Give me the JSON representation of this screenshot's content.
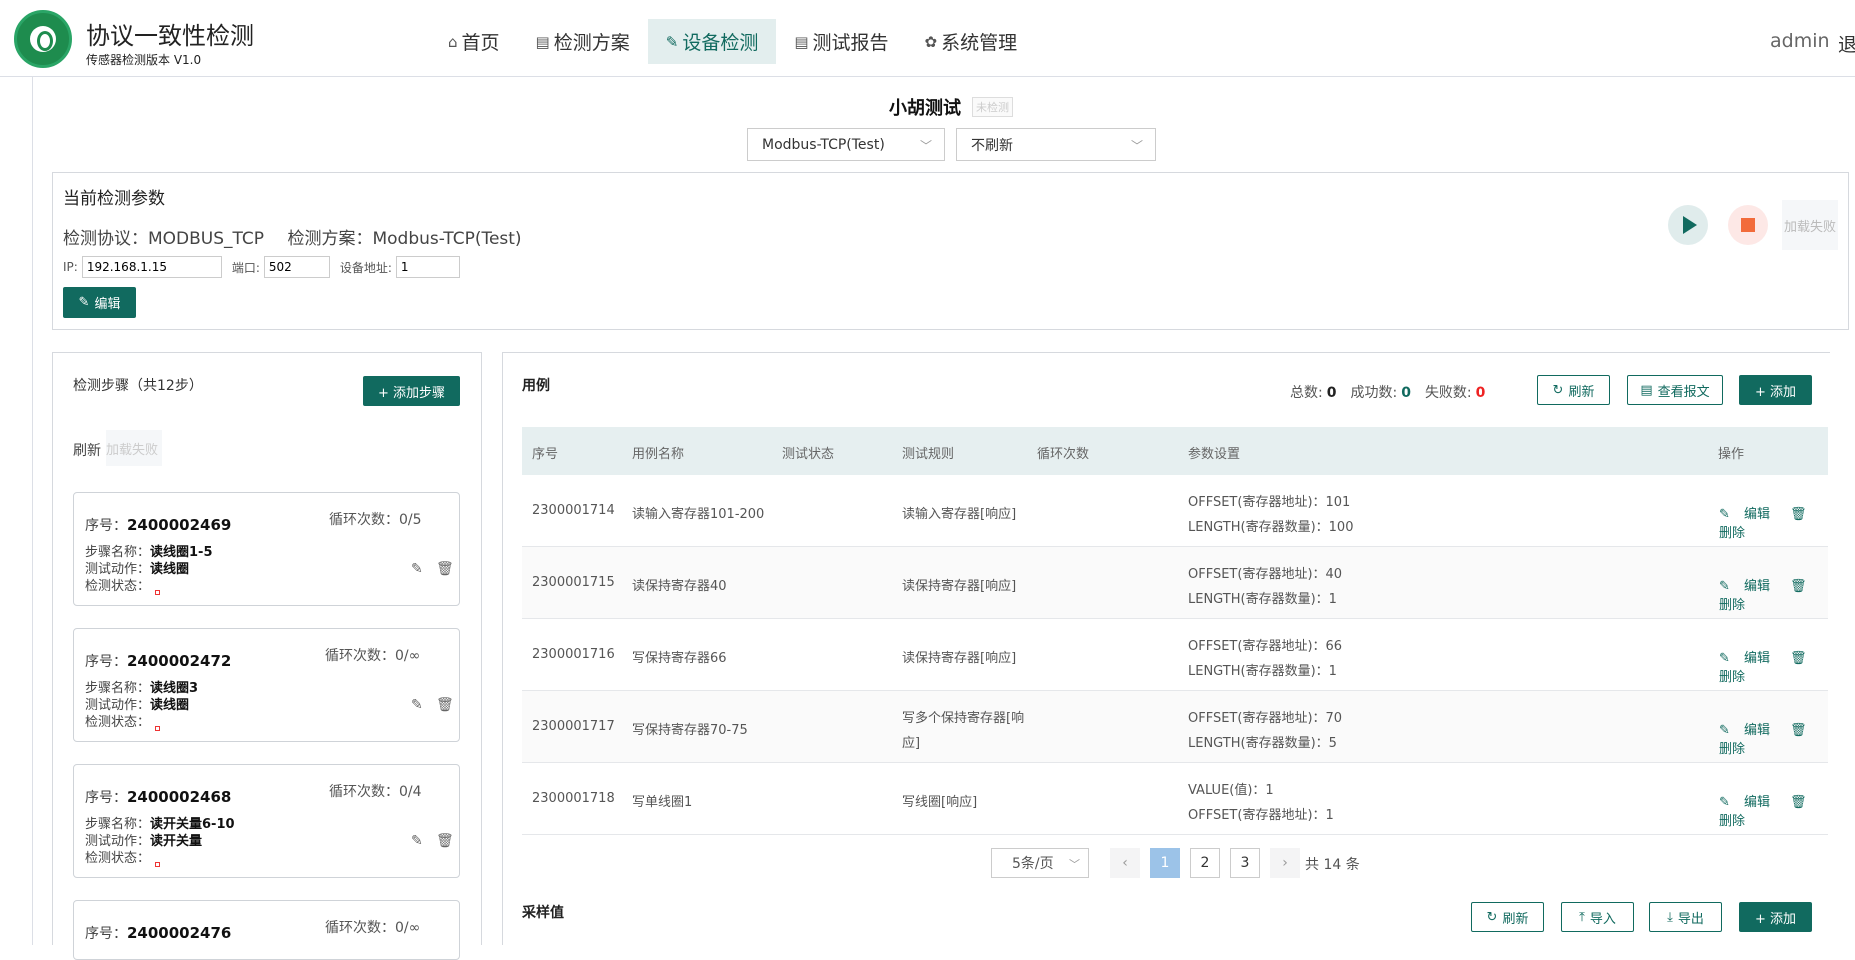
{
  "brand": {
    "title": "协议一致性检测",
    "subtitle": "传感器检测版本 V1.0"
  },
  "nav": [
    {
      "label": "首页",
      "icon": "home-icon"
    },
    {
      "label": "检测方案",
      "icon": "document-icon"
    },
    {
      "label": "设备检测",
      "icon": "wrench-icon",
      "active": true
    },
    {
      "label": "测试报告",
      "icon": "report-icon"
    },
    {
      "label": "系统管理",
      "icon": "gear-icon"
    }
  ],
  "user": {
    "name": "admin",
    "logout": "退"
  },
  "device": {
    "title": "小胡测试",
    "status": "未检测",
    "plan_select": "Modbus-TCP(Test)",
    "refresh_select": "不刷新"
  },
  "params": {
    "heading": "当前检测参数",
    "protocol_label": "检测协议：",
    "protocol": "MODBUS_TCP",
    "plan_label": "检测方案：",
    "plan": "Modbus-TCP(Test)",
    "ip_label": "IP:",
    "ip": "192.168.1.15",
    "port_label": "端口:",
    "port": "502",
    "addr_label": "设备地址:",
    "addr": "1",
    "edit": "编辑",
    "load_fail": "加载失败"
  },
  "steps": {
    "title": "检测步骤（共12步）",
    "add": "+ 添加步骤",
    "refresh": "刷新",
    "load_fail": "加载失败",
    "labels": {
      "num": "序号：",
      "loop": "循环次数：",
      "name": "步骤名称：",
      "action": "测试动作：",
      "status": "检测状态："
    },
    "items": [
      {
        "num": "2400002469",
        "loop": "0/5",
        "name": "读线圈1-5",
        "action": "读线圈"
      },
      {
        "num": "2400002472",
        "loop": "0/∞",
        "name": "读线圈3",
        "action": "读线圈"
      },
      {
        "num": "2400002468",
        "loop": "0/4",
        "name": "读开关量6-10",
        "action": "读开关量"
      },
      {
        "num": "2400002476",
        "loop": "0/∞"
      }
    ]
  },
  "cases": {
    "title": "用例",
    "total_label": "总数:",
    "total": "0",
    "success_label": "成功数:",
    "success": "0",
    "fail_label": "失败数:",
    "fail": "0",
    "refresh": "刷新",
    "view_report": "查看报文",
    "add": "+ 添加",
    "columns": [
      "序号",
      "用例名称",
      "测试状态",
      "测试规则",
      "循环次数",
      "参数设置",
      "操作"
    ],
    "edit": "编辑",
    "delete": "删除",
    "rows": [
      {
        "id": "2300001714",
        "name": "读输入寄存器101-200",
        "rule": "读输入寄存器[响应]",
        "p1": "OFFSET(寄存器地址)：101",
        "p2": "LENGTH(寄存器数量)：100"
      },
      {
        "id": "2300001715",
        "name": "读保持寄存器40",
        "rule": "读保持寄存器[响应]",
        "p1": "OFFSET(寄存器地址)：40",
        "p2": "LENGTH(寄存器数量)：1"
      },
      {
        "id": "2300001716",
        "name": "写保持寄存器66",
        "rule": "读保持寄存器[响应]",
        "p1": "OFFSET(寄存器地址)：66",
        "p2": "LENGTH(寄存器数量)：1"
      },
      {
        "id": "2300001717",
        "name": "写保持寄存器70-75",
        "rule": "写多个保持寄存器[响",
        "rule2": "应]",
        "p1": "OFFSET(寄存器地址)：70",
        "p2": "LENGTH(寄存器数量)：5"
      },
      {
        "id": "2300001718",
        "name": "写单线圈1",
        "rule": "写线圈[响应]",
        "p1": "VALUE(值)：1",
        "p2": "OFFSET(寄存器地址)：1"
      }
    ],
    "pager": {
      "size": "5条/页",
      "pages": [
        "1",
        "2",
        "3"
      ],
      "current": "1",
      "total": "共 14 条"
    }
  },
  "samples": {
    "title": "采样值",
    "refresh": "刷新",
    "import": "导入",
    "export": "导出",
    "add": "+ 添加"
  }
}
